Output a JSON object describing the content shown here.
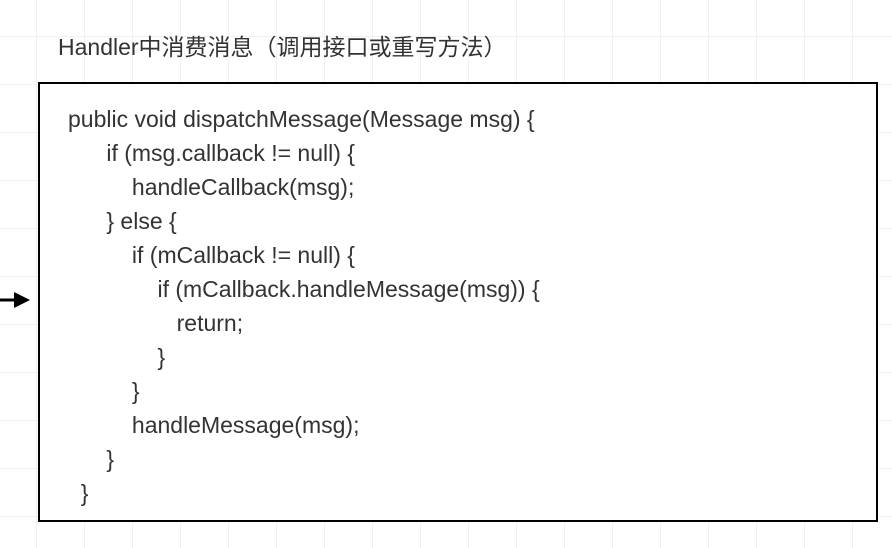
{
  "title": "Handler中消费消息（调用接口或重写方法）",
  "code": {
    "line1": "public void dispatchMessage(Message msg) {",
    "line2": "      if (msg.callback != null) {",
    "line3": "          handleCallback(msg);",
    "line4": "      } else {",
    "line5": "          if (mCallback != null) {",
    "line6": "              if (mCallback.handleMessage(msg)) {",
    "line7": "                 return;",
    "line8": "              }",
    "line9": "          }",
    "line10": "          handleMessage(msg);",
    "line11": "      }",
    "line12": "  }"
  }
}
